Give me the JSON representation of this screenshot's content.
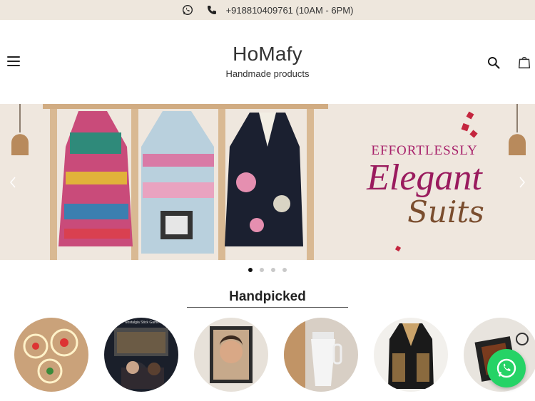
{
  "topbar": {
    "contact_text": "+918810409761 (10AM - 6PM)",
    "icons": [
      "whatsapp-icon",
      "phone-icon"
    ]
  },
  "header": {
    "brand_name": "HoMafy",
    "tagline": "Handmade products",
    "icons": [
      "menu-icon",
      "search-icon",
      "cart-icon"
    ]
  },
  "banner": {
    "line1": "EFFORTLESSLY",
    "line2": "Elegant",
    "line3": "Suits",
    "active_slide": 1,
    "slide_count": 4
  },
  "handpicked": {
    "title": "Handpicked",
    "items": [
      {
        "subject": "fairy-lights"
      },
      {
        "subject": "gaming-setup"
      },
      {
        "subject": "framed-portrait"
      },
      {
        "subject": "tumbler"
      },
      {
        "subject": "embroidered-jacket"
      },
      {
        "subject": "wallet"
      }
    ],
    "poster_text": "Nostalgia Stick Game"
  },
  "colors": {
    "topbar_bg": "#eee7dd",
    "accent_magenta": "#9a1b5e",
    "whatsapp_green": "#25d366"
  }
}
